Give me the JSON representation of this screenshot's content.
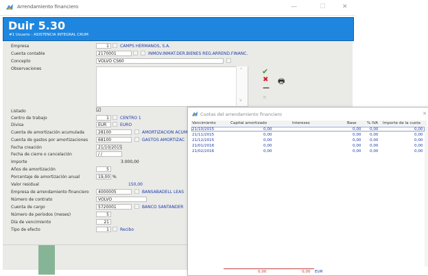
{
  "window": {
    "title": "Arrendamiento financiero",
    "min": "—",
    "max": "□",
    "close": "✕"
  },
  "header": {
    "title": "Duir 5.30",
    "subtitle": "#1 Usuario : ASISTENCIA INTEGRAL CRUM"
  },
  "form": {
    "empresa": {
      "label": "Empresa",
      "value": "1",
      "desc": "CAMPS HERMANOS, S.A."
    },
    "cuenta_contable": {
      "label": "Cuenta contable",
      "value": "2170001",
      "desc": "INMOV.INMAT.DER.BIENES REG.ARREND.FINANC."
    },
    "concepto": {
      "label": "Concepto",
      "value": "VOLVO CS60"
    },
    "observaciones": {
      "label": "Observaciones"
    },
    "listado": {
      "label": "Listado",
      "checked": "☑"
    },
    "centro": {
      "label": "Centro de trabajo",
      "value": "1",
      "desc": "CENTRO 1"
    },
    "divisa": {
      "label": "Divisa",
      "value": "EUR",
      "desc": "EURO"
    },
    "cta_amort_acum": {
      "label": "Cuenta de amortización acumulada",
      "value": "28100",
      "desc": "AMORTIZACION ACUM"
    },
    "cta_gastos": {
      "label": "Cuenta de gastos por amortizaciones",
      "value": "68100",
      "desc": "GASTOS AMORTIZAC"
    },
    "fecha_creacion": {
      "label": "Fecha creación",
      "value": "21/10/2015"
    },
    "fecha_cierre": {
      "label": "Fecha de cierre o cancelación",
      "value": " / /"
    },
    "importe": {
      "label": "Importe",
      "value": "3.000,00"
    },
    "anos_amort": {
      "label": "Años de amortización",
      "value": "5"
    },
    "porc_amort": {
      "label": "Porcentaje de amortización anual",
      "value": "19,00",
      "unit": "%"
    },
    "valor_residual": {
      "label": "Valor residual",
      "value": "150,00"
    },
    "empresa_arr": {
      "label": "Empresa de arrendamiento financiero",
      "value": "4000005",
      "desc": "BANSABADELL LEAS"
    },
    "num_contrato": {
      "label": "Número de contrato",
      "value": "VOLVO"
    },
    "cta_cargo": {
      "label": "Cuenta de cargo",
      "value": "5720001",
      "desc": "BANCO SANTANDER"
    },
    "num_periodos": {
      "label": "Número de períodos (meses)",
      "value": "5"
    },
    "dia_venc": {
      "label": "Día de vencimiento",
      "value": "21"
    },
    "tipo_efecto": {
      "label": "Tipo de efecto",
      "value": "1",
      "desc": "Recibo"
    }
  },
  "actions": {
    "accept": "✔",
    "cancel": "✖",
    "delete": "—",
    "print": "🖶",
    "extra": "≡"
  },
  "popup": {
    "title": "Cuotas del arrendamiento financiero",
    "close": "✕",
    "columns": [
      "Vencimiento",
      "Capital amortizado",
      "Intereses",
      "Base",
      "% IVA",
      "Importe de la cuota"
    ],
    "rows": [
      [
        "21/10/2015",
        "0,00",
        "",
        "0,00",
        "0,00",
        "0,00"
      ],
      [
        "21/11/2015",
        "0,00",
        "",
        "0,00",
        "0,00",
        "0,00"
      ],
      [
        "21/12/2015",
        "0,00",
        "",
        "0,00",
        "0,00",
        "0,00"
      ],
      [
        "21/01/2016",
        "0,00",
        "",
        "0,00",
        "0,00",
        "0,00"
      ],
      [
        "21/02/2016",
        "0,00",
        "",
        "0,00",
        "0,00",
        "0,00"
      ]
    ],
    "totals": {
      "capital": "0,00",
      "total": "0,00",
      "currency": "EUR"
    }
  }
}
